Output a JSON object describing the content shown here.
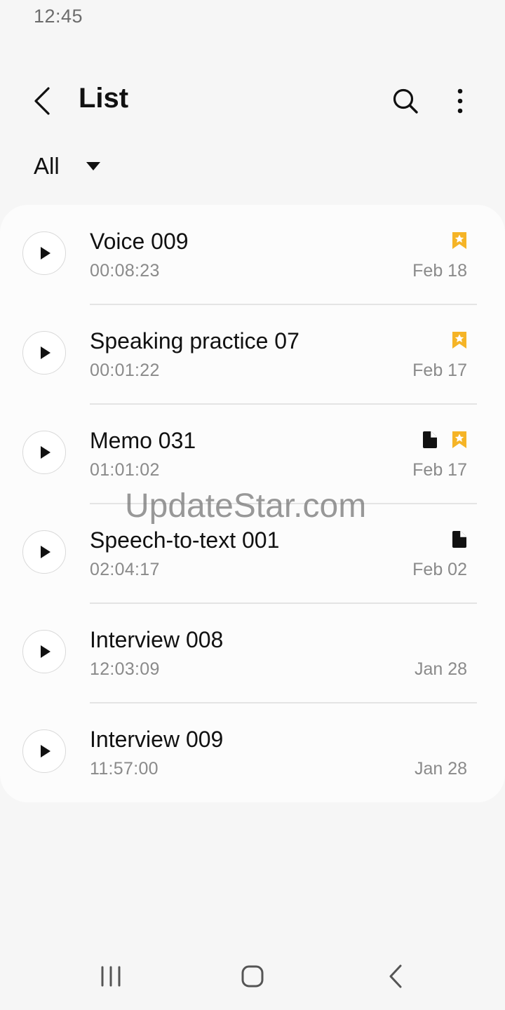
{
  "status_bar": {
    "time": "12:45"
  },
  "header": {
    "title": "List",
    "back_icon": "chevron-left-icon",
    "search_icon": "search-icon",
    "more_icon": "more-vertical-icon"
  },
  "filter": {
    "label": "All",
    "icon": "dropdown-arrow-icon"
  },
  "recordings": [
    {
      "title": "Voice 009",
      "duration": "00:08:23",
      "date": "Feb 18",
      "has_transcript": false,
      "bookmarked": true
    },
    {
      "title": "Speaking practice 07",
      "duration": "00:01:22",
      "date": "Feb 17",
      "has_transcript": false,
      "bookmarked": true
    },
    {
      "title": "Memo 031",
      "duration": "01:01:02",
      "date": "Feb 17",
      "has_transcript": true,
      "bookmarked": true
    },
    {
      "title": "Speech-to-text 001",
      "duration": "02:04:17",
      "date": "Feb 02",
      "has_transcript": true,
      "bookmarked": false
    },
    {
      "title": "Interview 008",
      "duration": "12:03:09",
      "date": "Jan 28",
      "has_transcript": false,
      "bookmarked": false
    },
    {
      "title": "Interview 009",
      "duration": "11:57:00",
      "date": "Jan 28",
      "has_transcript": false,
      "bookmarked": false
    }
  ],
  "watermark": "UpdateStar.com",
  "colors": {
    "bookmark": "#f5b426",
    "background": "#f6f6f6",
    "card": "#fcfcfc",
    "secondary_text": "#8a8a8a"
  },
  "nav_bar": {
    "recents_icon": "recent-apps-icon",
    "home_icon": "home-icon",
    "back_icon": "back-icon"
  }
}
